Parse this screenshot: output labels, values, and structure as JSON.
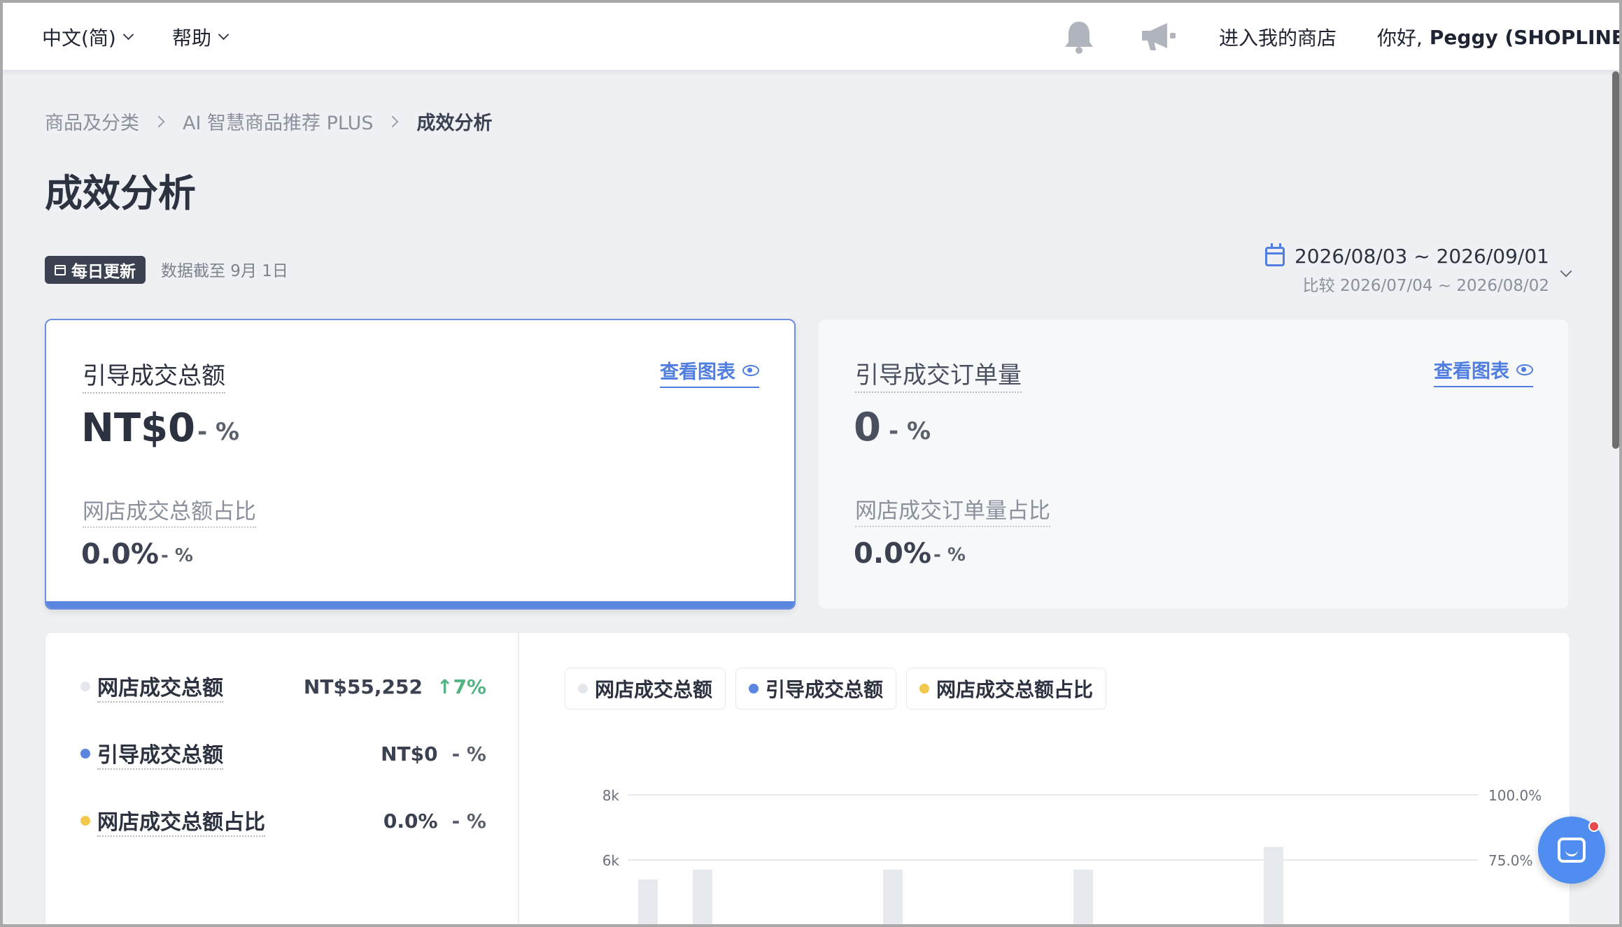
{
  "topbar": {
    "language": "中文(简)",
    "help": "帮助",
    "enter_shop": "进入我的商店",
    "greeting": "你好,",
    "user": "Peggy (SHOPLINE)"
  },
  "breadcrumb": [
    "商品及分类",
    "AI 智慧商品推荐 PLUS",
    "成效分析"
  ],
  "page_title": "成效分析",
  "update_badge": "每日更新",
  "data_as_of": "数据截至 9月 1日",
  "date_range": {
    "main": "2026/08/03 ~ 2026/09/01",
    "compare": "比较 2026/07/04 ~ 2026/08/02"
  },
  "cards": [
    {
      "title": "引导成交总额",
      "view_chart": "查看图表",
      "value": "NT$0",
      "change": "- %",
      "sub_title": "网店成交总额占比",
      "sub_value": "0.0%",
      "sub_change": "- %"
    },
    {
      "title": "引导成交订单量",
      "view_chart": "查看图表",
      "value": "0",
      "change": "- %",
      "sub_title": "网店成交订单量占比",
      "sub_value": "0.0%",
      "sub_change": "- %"
    }
  ],
  "legend_rows": [
    {
      "label": "网店成交总额",
      "value": "NT$55,252",
      "change": "↑7%",
      "color": "#e3e6eb"
    },
    {
      "label": "引导成交总额",
      "value": "NT$0",
      "change": "- %",
      "color": "#5b86e0"
    },
    {
      "label": "网店成交总额占比",
      "value": "0.0%",
      "change": "- %",
      "color": "#f2c94c"
    }
  ],
  "pills": [
    {
      "label": "网店成交总额",
      "color": "#e3e6eb"
    },
    {
      "label": "引导成交总额",
      "color": "#5b86e0"
    },
    {
      "label": "网店成交总额占比",
      "color": "#f2c94c"
    }
  ],
  "chart_data": {
    "type": "bar",
    "y_left_ticks": [
      "8k",
      "6k"
    ],
    "y_right_ticks": [
      "100.0%",
      "75.0%"
    ],
    "series": [
      {
        "name": "网店成交总额",
        "values": [
          5400,
          5700,
          5700,
          5700,
          6400
        ]
      }
    ],
    "grid": true
  },
  "colors": {
    "accent": "#4f7ee0",
    "positive": "#53b383",
    "chat_button": "#4f8ef0",
    "notification": "#e5484d"
  }
}
